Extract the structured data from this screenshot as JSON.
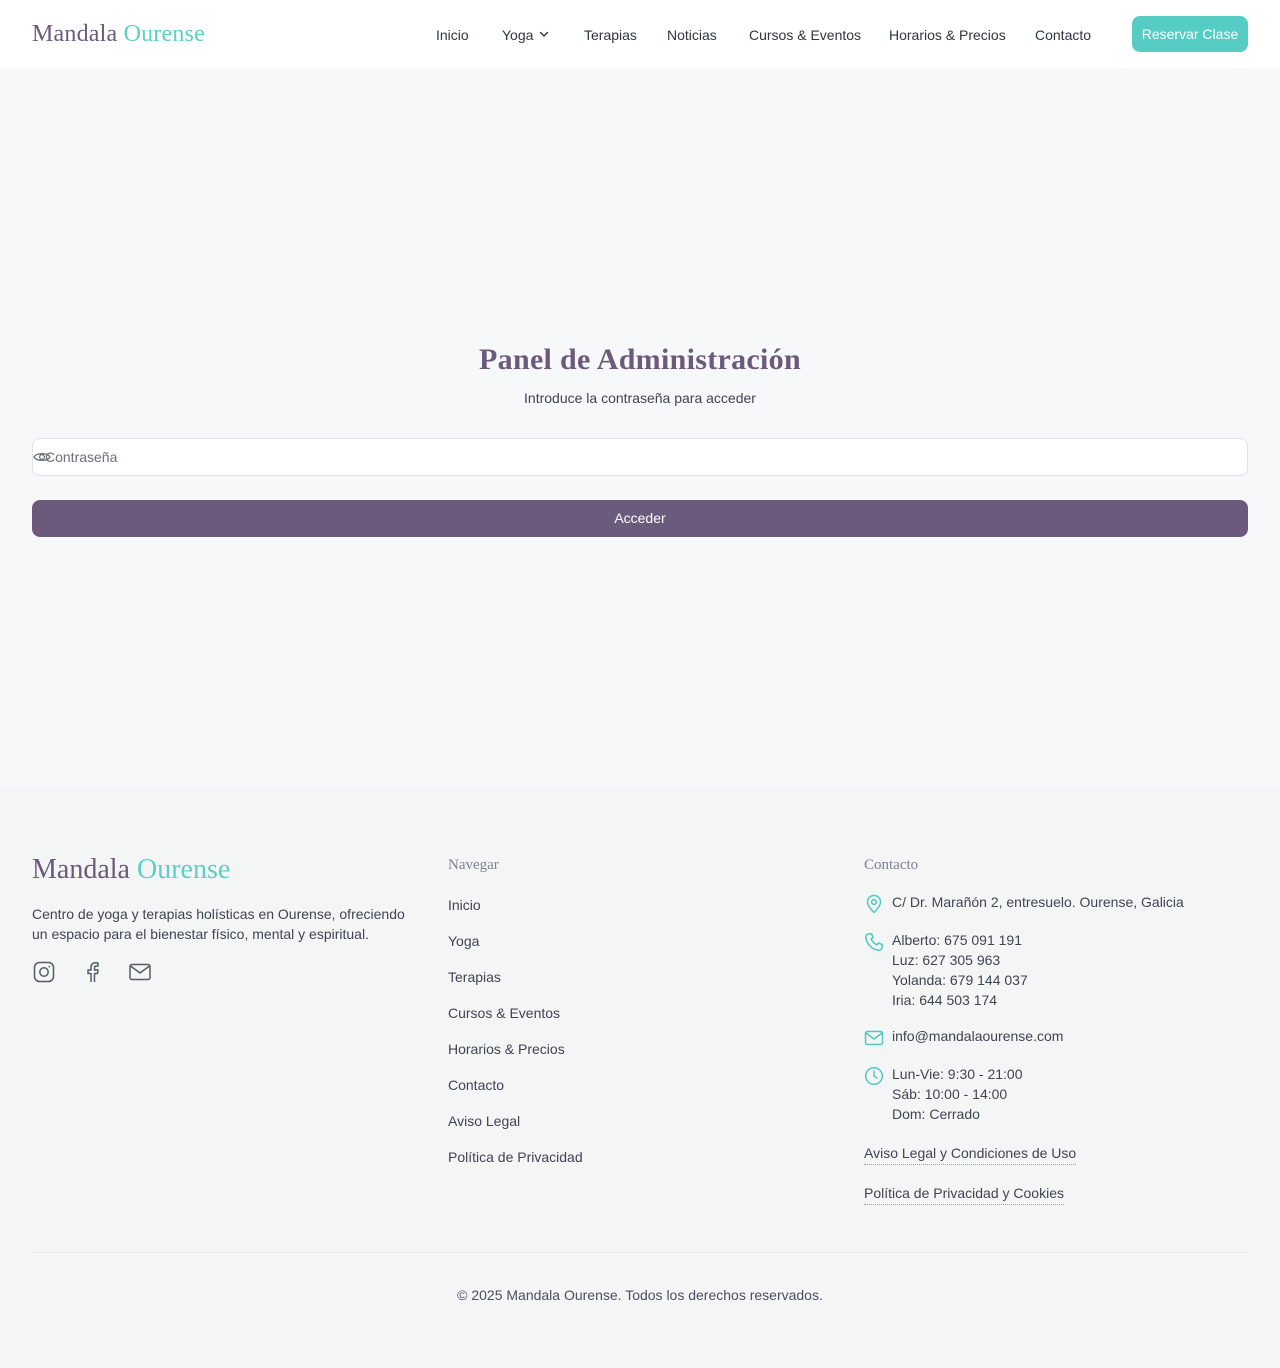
{
  "colors": {
    "brand_purple": "#6b5a7b",
    "brand_teal": "#55ccc4",
    "background": "#f7f8f9"
  },
  "header": {
    "logo_first": "Mandala",
    "logo_second": "Ourense",
    "nav": [
      {
        "label": "Inicio"
      },
      {
        "label": "Yoga",
        "has_dropdown": true,
        "icon": "chevron-down-icon"
      },
      {
        "label": "Terapias"
      },
      {
        "label": "Noticias"
      },
      {
        "label": "Cursos & Eventos"
      },
      {
        "label": "Horarios & Precios"
      },
      {
        "label": "Contacto"
      }
    ],
    "cta": "Reservar Clase"
  },
  "main": {
    "title": "Panel de Administración",
    "subtitle": "Introduce la contraseña para acceder",
    "password_placeholder": "Contraseña",
    "password_value": "",
    "password_icon": "eye-icon",
    "submit": "Acceder"
  },
  "footer": {
    "logo_first": "Mandala",
    "logo_second": "Ourense",
    "description": "Centro de yoga y terapias holísticas en Ourense, ofreciendo un espacio para el bienestar físico, mental y espiritual.",
    "social_icons": [
      "instagram-icon",
      "facebook-icon",
      "mail-icon"
    ],
    "nav_title": "Navegar",
    "nav_links": [
      "Inicio",
      "Yoga",
      "Terapias",
      "Cursos & Eventos",
      "Horarios & Precios",
      "Contacto",
      "Aviso Legal",
      "Política de Privacidad"
    ],
    "contact_title": "Contacto",
    "address": "C/ Dr. Marañón 2, entresuelo. Ourense, Galicia",
    "phones": [
      "Alberto: 675 091 191",
      "Luz: 627 305 963",
      "Yolanda: 679 144 037",
      "Iria: 644 503 174"
    ],
    "email": "info@mandalaourense.com",
    "hours": [
      "Lun-Vie: 9:30 - 21:00",
      "Sáb: 10:00 - 14:00",
      "Dom: Cerrado"
    ],
    "legal_link_1": "Aviso Legal y Condiciones de Uso",
    "legal_link_2": "Política de Privacidad y Cookies",
    "copyright": "© 2025 Mandala Ourense. Todos los derechos reservados."
  }
}
